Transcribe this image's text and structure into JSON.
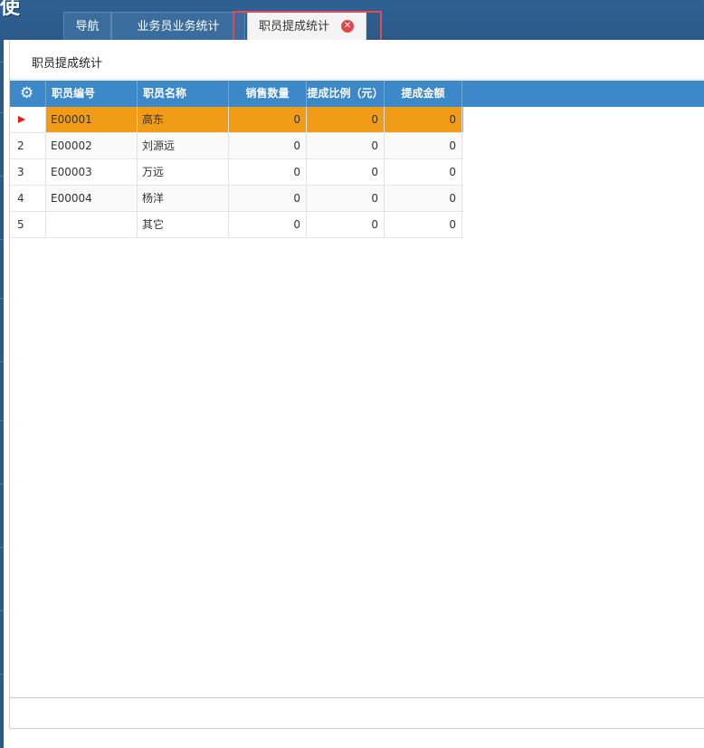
{
  "app": {
    "logo_fragment": "使"
  },
  "tabs": [
    {
      "label": "导航"
    },
    {
      "label": "业务员业务统计"
    },
    {
      "label": "职员提成统计",
      "active": true
    }
  ],
  "panel": {
    "title": "职员提成统计"
  },
  "grid": {
    "columns": [
      "职员编号",
      "职员名称",
      "销售数量",
      "提成比例（元）",
      "提成金额"
    ],
    "rows": [
      {
        "num": "",
        "code": "E00001",
        "name": "高东",
        "qty": "0",
        "ratio": "0",
        "amount": "0",
        "selected": true
      },
      {
        "num": "2",
        "code": "E00002",
        "name": "刘源远",
        "qty": "0",
        "ratio": "0",
        "amount": "0"
      },
      {
        "num": "3",
        "code": "E00003",
        "name": "万远",
        "qty": "0",
        "ratio": "0",
        "amount": "0"
      },
      {
        "num": "4",
        "code": "E00004",
        "name": "杨洋",
        "qty": "0",
        "ratio": "0",
        "amount": "0"
      },
      {
        "num": "5",
        "code": "",
        "name": "其它",
        "qty": "0",
        "ratio": "0",
        "amount": "0"
      }
    ]
  },
  "colors": {
    "header_bg": "#3d88c8",
    "selected_row": "#f09c16",
    "tab_close": "#e0494a",
    "highlight_box": "#e24a55"
  }
}
